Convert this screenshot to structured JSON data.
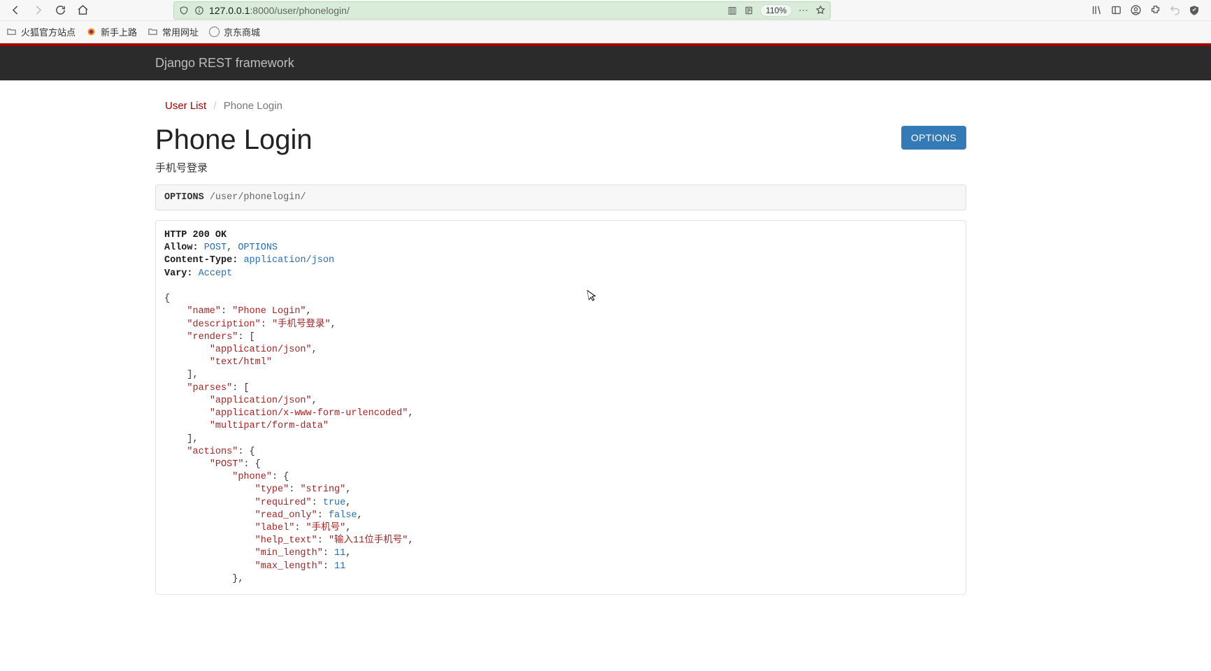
{
  "browser": {
    "url_display_prefix": "127.0.0.1",
    "url_display_suffix": ":8000/user/phonelogin/",
    "zoom": "110%"
  },
  "bookmarks": {
    "item1": "火狐官方站点",
    "item2": "新手上路",
    "item3": "常用网址",
    "item4": "京东商城"
  },
  "navbar": {
    "brand": "Django REST framework"
  },
  "breadcrumb": {
    "link1": "User List",
    "current": "Phone Login"
  },
  "page": {
    "title": "Phone Login",
    "subtitle": "手机号登录",
    "options_button": "OPTIONS"
  },
  "request_info": {
    "method": "OPTIONS",
    "path": "/user/phonelogin/"
  },
  "response": {
    "status_line": "HTTP 200 OK",
    "headers": {
      "allow_label": "Allow:",
      "allow_values": [
        "POST",
        "OPTIONS"
      ],
      "ctype_label": "Content-Type:",
      "ctype_value": "application/json",
      "vary_label": "Vary:",
      "vary_value": "Accept"
    },
    "body": {
      "name": "Phone Login",
      "description": "手机号登录",
      "renders": [
        "application/json",
        "text/html"
      ],
      "parses": [
        "application/json",
        "application/x-www-form-urlencoded",
        "multipart/form-data"
      ],
      "actions": {
        "POST": {
          "phone": {
            "type": "string",
            "required": true,
            "read_only": false,
            "label": "手机号",
            "help_text": "输入11位手机号",
            "min_length": 11,
            "max_length": 11
          }
        }
      }
    }
  }
}
